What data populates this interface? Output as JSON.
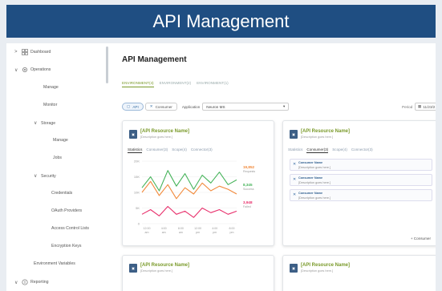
{
  "banner": {
    "title": "API Management"
  },
  "sidebar": {
    "items": [
      {
        "label": "Dashboard",
        "chevron": ">",
        "icon": "dashboard-icon"
      },
      {
        "label": "Operations",
        "chevron": "∨",
        "icon": "gear-icon"
      },
      {
        "label": "Manage"
      },
      {
        "label": "Monitor"
      },
      {
        "label": "Storage",
        "chevron": "∨"
      },
      {
        "label": "Manage"
      },
      {
        "label": "Jobs"
      },
      {
        "label": "Security",
        "chevron": "∨"
      },
      {
        "label": "Credentials"
      },
      {
        "label": "OAuth Providers"
      },
      {
        "label": "Access Control Lists"
      },
      {
        "label": "Encryption Keys"
      },
      {
        "label": "Environment Variables"
      },
      {
        "label": "Reporting",
        "chevron": "∨",
        "icon": "reporting-icon"
      }
    ]
  },
  "main": {
    "title": "API Management",
    "env_tabs": [
      "ENVIRONMENT(4)",
      "ENVIRONMENT(2)",
      "ENVIRONMENT(1)"
    ],
    "filters": {
      "api_label": "API",
      "consumer_label": "Consumer",
      "application_label": "Application",
      "application_value": "Neuron MS",
      "period_label": "Period",
      "period_value": "11/23/2"
    },
    "cards": [
      {
        "title": "[API Resource Name]",
        "desc": "[Description goes here.]",
        "tabs": [
          "Statistics",
          "Consumer(3)",
          "Scope(4)",
          "Connector(3)"
        ],
        "active_tab": 0
      },
      {
        "title": "[API Resource Name]",
        "desc": "[Description goes here.]",
        "tabs": [
          "Statistics",
          "Consumer(3)",
          "Scope(4)",
          "Connector(3)"
        ],
        "active_tab": 1,
        "consumers": [
          {
            "name": "Consumer Name",
            "desc": "[Description goes here.]"
          },
          {
            "name": "Consumer Name",
            "desc": "[Description goes here.]"
          },
          {
            "name": "Consumer Name",
            "desc": "[Description goes here.]"
          }
        ],
        "add_label": "+ Consumer"
      },
      {
        "title": "[API Resource Name]",
        "desc": "[Description goes here.]"
      },
      {
        "title": "[API Resource Name]",
        "desc": "[Description goes here.]"
      }
    ]
  },
  "chart_data": {
    "type": "line",
    "x": [
      "12:00 am",
      "4:00 am",
      "8:00 am",
      "12:00 pm",
      "4:00 pm",
      "8:00 pm"
    ],
    "y_ticks": [
      "20K",
      "15K",
      "10K",
      "5K",
      "0"
    ],
    "ylim": [
      0,
      20000
    ],
    "series": [
      {
        "name": "Requests",
        "color": "#f28a3c",
        "values": [
          10000,
          13500,
          9000,
          12500,
          8000,
          11500,
          9500,
          13000,
          10500,
          12000,
          11000,
          9500
        ]
      },
      {
        "name": "Success",
        "color": "#46b35a",
        "values": [
          11500,
          15000,
          10500,
          17000,
          12000,
          16000,
          11000,
          15500,
          13000,
          16500,
          12500,
          14000
        ]
      },
      {
        "name": "Failed",
        "color": "#e8306c",
        "values": [
          3000,
          4500,
          2500,
          5500,
          3000,
          4000,
          2000,
          5000,
          3500,
          4500,
          3000,
          4000
        ]
      }
    ],
    "legend": [
      {
        "value": "19,852",
        "label": "Requests",
        "color": "#f28a3c"
      },
      {
        "value": "8,345",
        "label": "Success",
        "color": "#46b35a"
      },
      {
        "value": "3,948",
        "label": "Failed",
        "color": "#e8306c"
      }
    ]
  }
}
